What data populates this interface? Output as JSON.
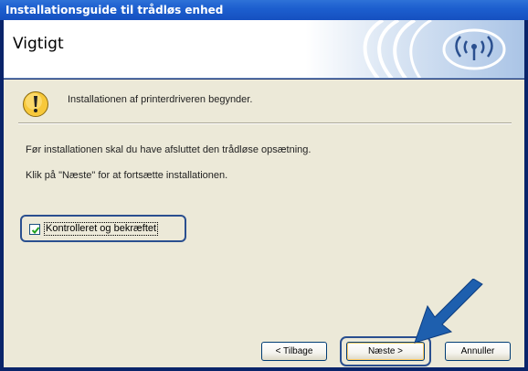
{
  "window": {
    "title": "Installationsguide til trådløs enhed"
  },
  "header": {
    "title": "Vigtigt",
    "logo_icon": "wireless-signal-icon"
  },
  "info": {
    "icon": "warning-icon",
    "text": "Installationen af printerdriveren begynder."
  },
  "instructions": [
    "Før installationen skal du have afsluttet den trådløse opsætning.",
    "Klik på \"Næste\" for at fortsætte installationen."
  ],
  "confirm": {
    "label": "Kontrolleret og bekræftet",
    "checked": true
  },
  "buttons": {
    "back": "< Tilbage",
    "next": "Næste >",
    "cancel": "Annuller"
  },
  "colors": {
    "titlebar": "#1d5fcf",
    "dialog_bg": "#ece9d8",
    "highlight": "#2a4f8f",
    "arrow": "#1e5fae"
  }
}
